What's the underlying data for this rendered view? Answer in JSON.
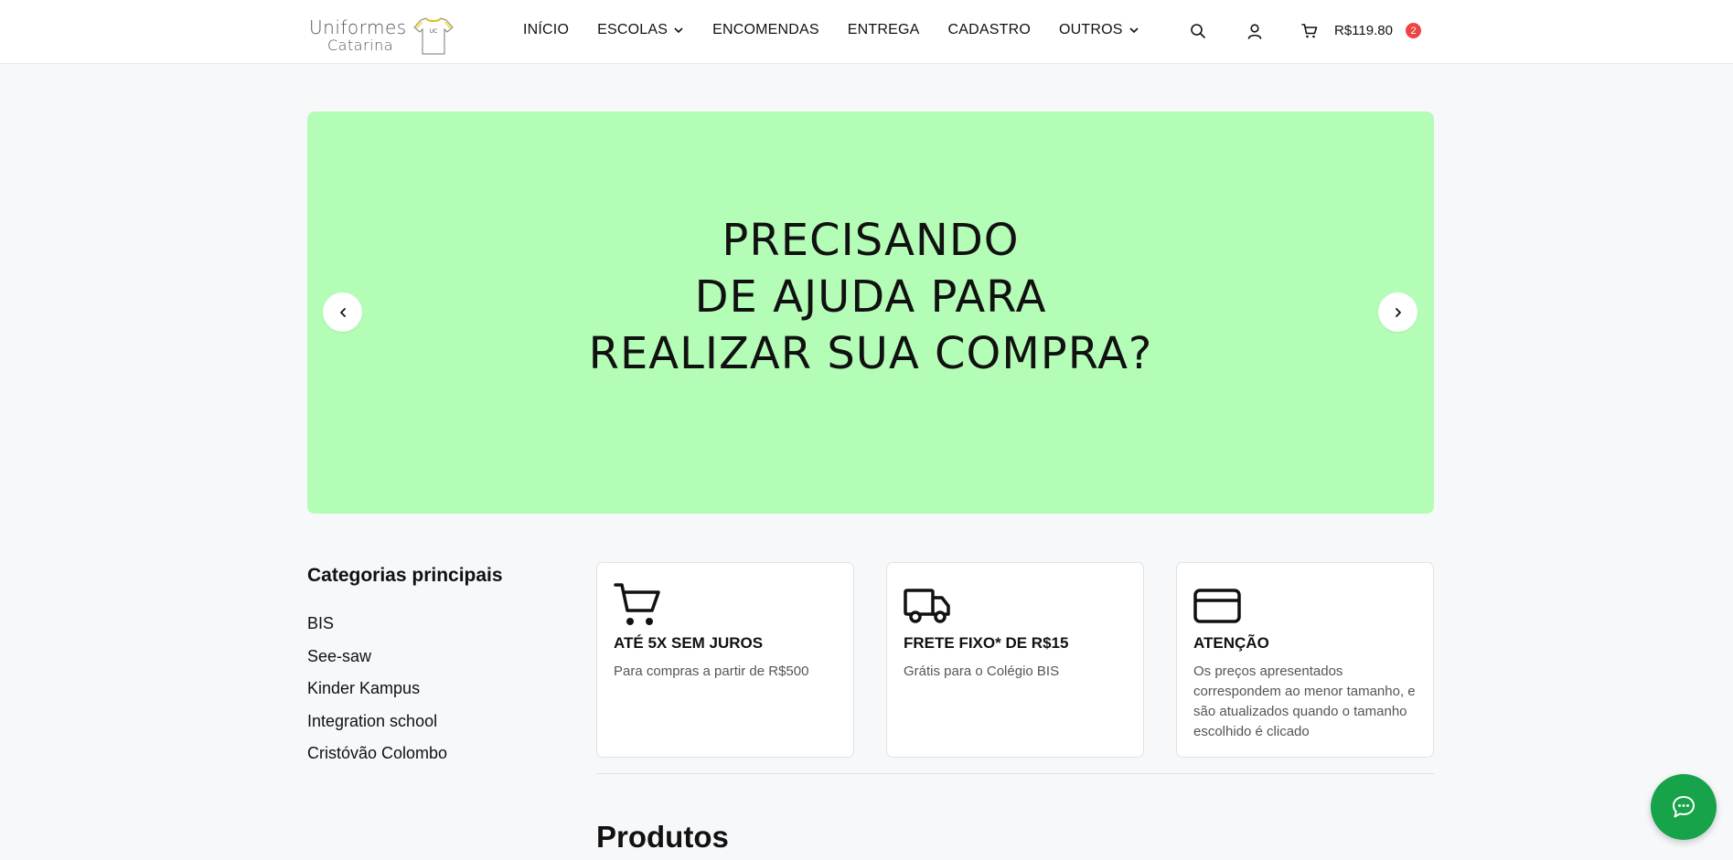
{
  "logo": {
    "line1": "Uniformes",
    "line2": "Catarina",
    "shirt_mark": "UC"
  },
  "nav": {
    "items": [
      {
        "label": "INÍCIO"
      },
      {
        "label": "ESCOLAS"
      },
      {
        "label": "ENCOMENDAS"
      },
      {
        "label": "ENTREGA"
      },
      {
        "label": "CADASTRO"
      },
      {
        "label": "OUTROS"
      }
    ]
  },
  "header": {
    "icons": {
      "search": "search-icon",
      "account": "user-icon",
      "cart": "cart-icon"
    },
    "cart_total": "R$119.80",
    "cart_count": "2"
  },
  "banner": {
    "lines": [
      "PRECISANDO",
      "DE AJUDA PARA",
      "REALIZAR SUA COMPRA?"
    ],
    "background": "#b4fdb7"
  },
  "categories": {
    "title": "Categorias principais",
    "items": [
      "BIS",
      "See-saw",
      "Kinder Kampus",
      "Integration school",
      "Cristóvão Colombo"
    ]
  },
  "features": [
    {
      "icon": "cart-icon",
      "title": "ATÉ 5X SEM JUROS",
      "text": "Para compras a partir de R$500"
    },
    {
      "icon": "truck-icon",
      "title": "FRETE FIXO* DE R$15",
      "text": "Grátis para o Colégio BIS"
    },
    {
      "icon": "credit-card-icon",
      "title": "ATENÇÃO",
      "text": "Os preços apresentados correspondem ao menor tamanho, e são atualizados quando o tamanho escolhido é clicado"
    }
  ],
  "products": {
    "title": "Produtos"
  },
  "chat": {
    "icon": "chat-icon",
    "color": "#16a34a"
  }
}
